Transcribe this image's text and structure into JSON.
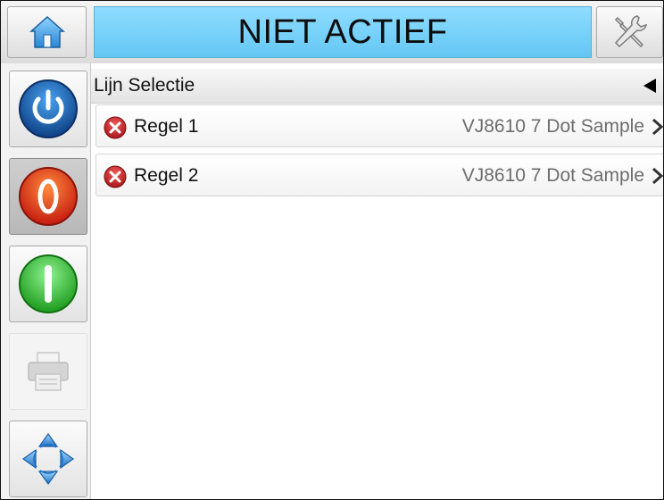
{
  "status": {
    "text": "NIET ACTIEF",
    "background_color": "#6fcdf6"
  },
  "toolbar": {
    "home_icon": "home-icon",
    "tools_icon": "tools-icon"
  },
  "sidebar": {
    "items": [
      {
        "name": "power",
        "icon": "power-icon",
        "color": "#1f6fc2"
      },
      {
        "name": "stop",
        "icon": "stop-icon",
        "color": "#e8531f",
        "active": true
      },
      {
        "name": "start",
        "icon": "start-icon",
        "color": "#3cc63c"
      },
      {
        "name": "print",
        "icon": "printer-icon",
        "disabled": true
      },
      {
        "name": "navigate",
        "icon": "navigate-arrows-icon",
        "color": "#2a86d4"
      }
    ]
  },
  "panel": {
    "title": "Lijn Selectie",
    "back_icon": "back-arrow-icon",
    "rows": [
      {
        "label": "Regel 1",
        "value": "VJ8610 7 Dot Sample",
        "status_icon": "error-icon"
      },
      {
        "label": "Regel 2",
        "value": "VJ8610 7 Dot Sample",
        "status_icon": "error-icon"
      }
    ]
  }
}
